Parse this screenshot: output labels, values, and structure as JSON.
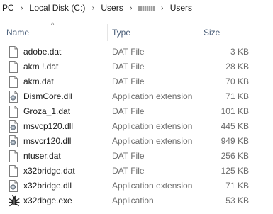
{
  "breadcrumb": {
    "items": [
      "PC",
      "Local Disk (C:)",
      "Users",
      "Users"
    ],
    "separator": "›"
  },
  "columns": {
    "name": "Name",
    "type": "Type",
    "size": "Size",
    "sort_indicator": "^"
  },
  "files": [
    {
      "name": "adobe.dat",
      "type": "DAT File",
      "size": "3 KB",
      "icon": "document-icon"
    },
    {
      "name": "akm    !.dat",
      "type": "DAT File",
      "size": "28 KB",
      "icon": "document-icon"
    },
    {
      "name": "akm.dat",
      "type": "DAT File",
      "size": "70 KB",
      "icon": "document-icon"
    },
    {
      "name": "DismCore.dll",
      "type": "Application extension",
      "size": "71 KB",
      "icon": "dll-gear-icon"
    },
    {
      "name": "Groza_1.dat",
      "type": "DAT File",
      "size": "101 KB",
      "icon": "document-icon"
    },
    {
      "name": "msvcp120.dll",
      "type": "Application extension",
      "size": "445 KB",
      "icon": "dll-gear-icon"
    },
    {
      "name": "msvcr120.dll",
      "type": "Application extension",
      "size": "949 KB",
      "icon": "dll-gear-icon"
    },
    {
      "name": "ntuser.dat",
      "type": "DAT File",
      "size": "256 KB",
      "icon": "document-icon"
    },
    {
      "name": "x32bridge.dat",
      "type": "DAT File",
      "size": "125 KB",
      "icon": "document-icon"
    },
    {
      "name": "x32bridge.dll",
      "type": "Application extension",
      "size": "71 KB",
      "icon": "dll-gear-icon"
    },
    {
      "name": "x32dbge.exe",
      "type": "Application",
      "size": "53 KB",
      "icon": "bug-icon"
    }
  ]
}
